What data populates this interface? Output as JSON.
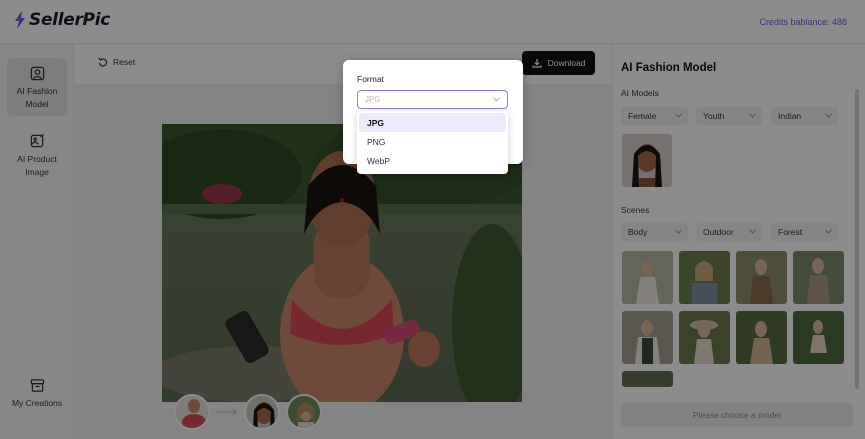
{
  "app": {
    "brand": "SellerPic",
    "credits": "Credits bablance: 488"
  },
  "leftnav": {
    "items": [
      {
        "label_line1": "AI Fashion",
        "label_line2": "Model",
        "icon": "user-square-icon"
      },
      {
        "label_line1": "AI Product",
        "label_line2": "Image",
        "icon": "image-edit-icon"
      },
      {
        "label_line1": "My Creations",
        "label_line2": "",
        "icon": "archive-box-icon"
      }
    ]
  },
  "toolbar": {
    "reset_label": "Reset",
    "download_label": "Download"
  },
  "panel": {
    "title": "AI Fashion Model",
    "models_label": "AI Models",
    "filters": {
      "gender": "Female",
      "age": "Youth",
      "ethnicity": "Indian"
    },
    "scenes_label": "Scenes",
    "scene_filters": {
      "shot": "Body",
      "location": "Outdoor",
      "setting": "Forest"
    },
    "choose_button": "Please choose a model"
  },
  "format_dialog": {
    "label": "Format",
    "placeholder": "JPG",
    "options": [
      "JPG",
      "PNG",
      "WebP"
    ],
    "highlighted": "JPG"
  },
  "colors": {
    "accent": "#6d5bd8",
    "select_border": "#8f7ce6",
    "download_bg": "#111111"
  }
}
